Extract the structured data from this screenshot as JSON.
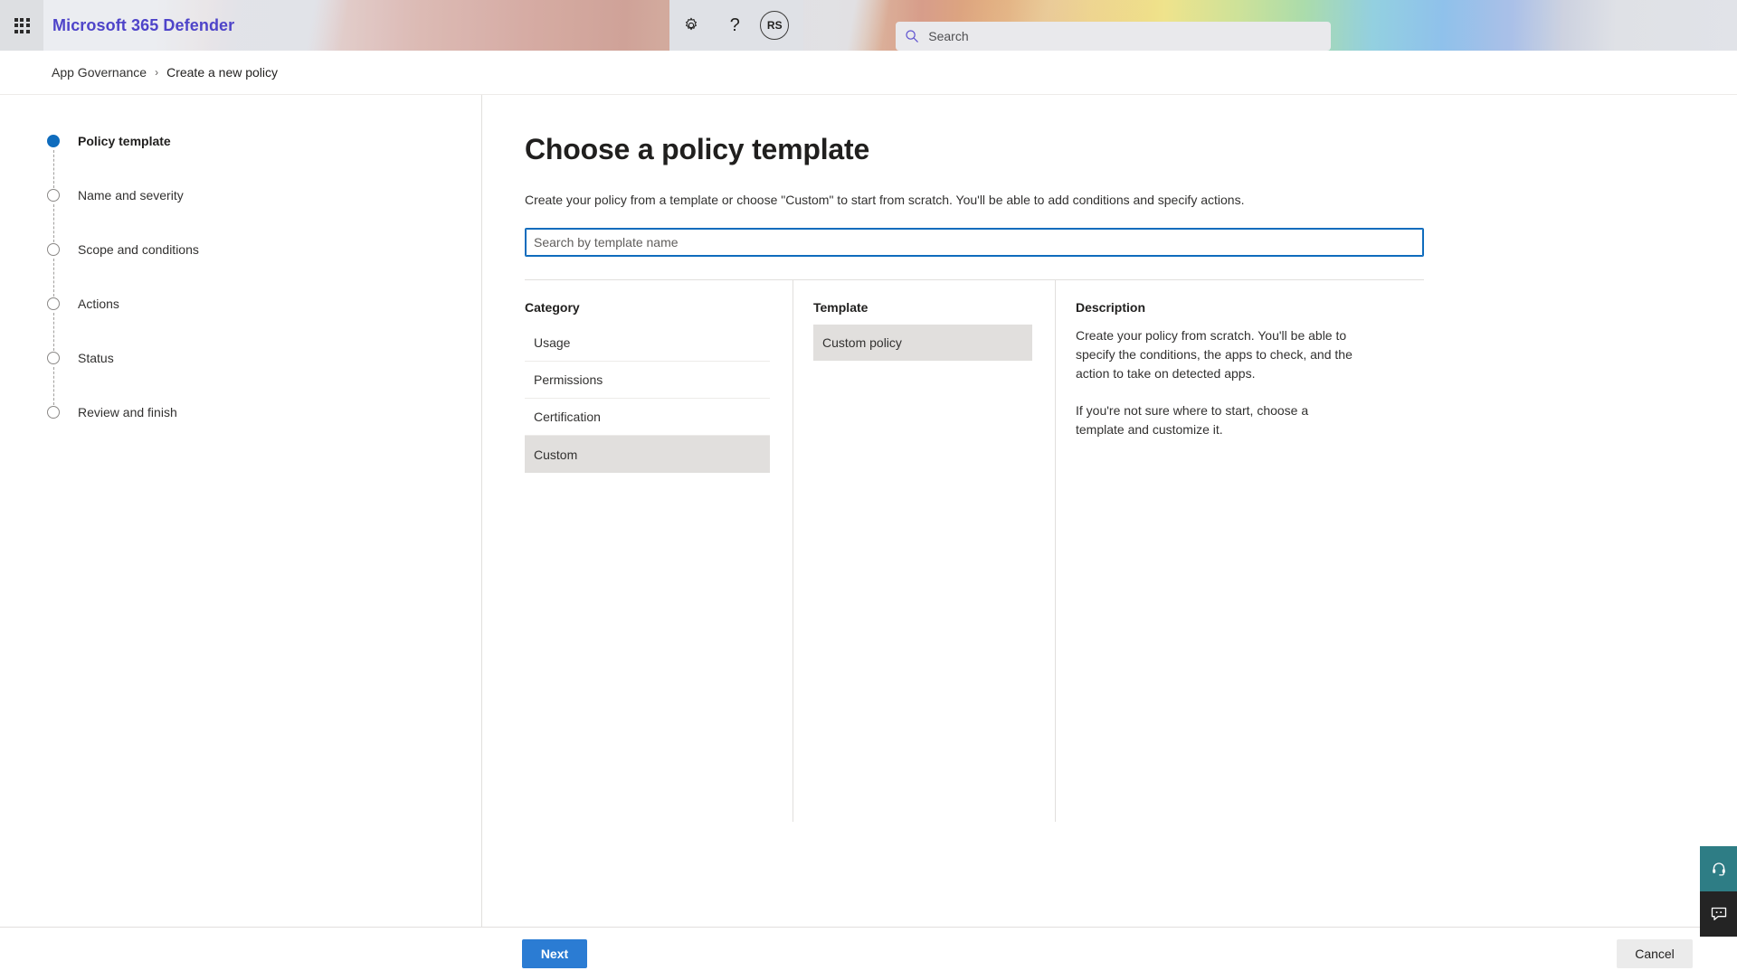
{
  "suite": {
    "waffle_label": "App launcher",
    "brand": "Microsoft 365 Defender",
    "search_placeholder": "Search",
    "search_value": "",
    "settings_label": "Settings",
    "help_label": "?",
    "avatar_initials": "RS"
  },
  "breadcrumb": {
    "items": [
      {
        "label": "App Governance"
      },
      {
        "label": "Create a new policy"
      }
    ],
    "separator": "›"
  },
  "wizard": {
    "steps": [
      {
        "label": "Policy template",
        "state": "active"
      },
      {
        "label": "Name and severity",
        "state": "pending"
      },
      {
        "label": "Scope and conditions",
        "state": "pending"
      },
      {
        "label": "Actions",
        "state": "pending"
      },
      {
        "label": "Status",
        "state": "pending"
      },
      {
        "label": "Review and finish",
        "state": "pending"
      }
    ]
  },
  "main": {
    "title": "Choose a policy template",
    "subtitle": "Create your policy from a template or choose \"Custom\" to start from scratch. You'll be able to add conditions and specify actions.",
    "template_search_placeholder": "Search by template name",
    "template_search_value": "",
    "category": {
      "heading": "Category",
      "items": [
        {
          "label": "Usage",
          "selected": false
        },
        {
          "label": "Permissions",
          "selected": false
        },
        {
          "label": "Certification",
          "selected": false
        },
        {
          "label": "Custom",
          "selected": true
        }
      ]
    },
    "template": {
      "heading": "Template",
      "items": [
        {
          "label": "Custom policy",
          "selected": true
        }
      ]
    },
    "description": {
      "heading": "Description",
      "paragraphs": [
        "Create your policy from scratch. You'll be able to specify the conditions, the apps to check, and the action to take on detected apps.",
        "If you're not sure where to start, choose a template and customize it."
      ]
    }
  },
  "footer": {
    "next_label": "Next",
    "cancel_label": "Cancel"
  },
  "side_widgets": {
    "support_label": "Support",
    "feedback_label": "Feedback"
  },
  "colors": {
    "brand_purple": "#4e44c9",
    "accent_blue": "#0f6cbd",
    "primary_button": "#2b7cd3",
    "support_teal": "#2e7d85",
    "feedback_dark": "#242424"
  }
}
